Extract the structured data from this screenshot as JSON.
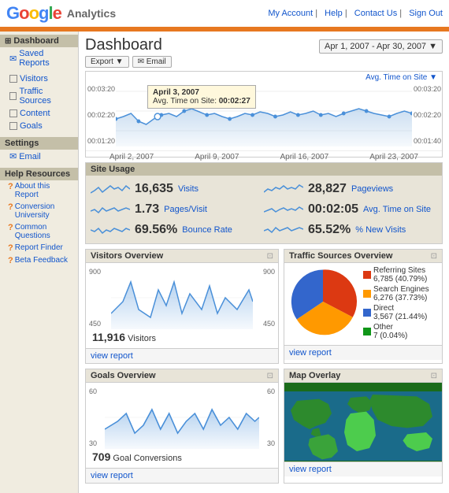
{
  "header": {
    "logo_letters": [
      "G",
      "o",
      "o",
      "g",
      "l",
      "e"
    ],
    "analytics_label": "Analytics",
    "nav_links": [
      "My Account",
      "Help",
      "Contact Us",
      "Sign Out"
    ]
  },
  "sidebar": {
    "sections": [
      {
        "title": "Dashboard",
        "items": [
          {
            "label": "Saved Reports",
            "icon": "📋",
            "active": false
          }
        ]
      },
      {
        "title": null,
        "items": [
          {
            "label": "Visitors",
            "icon": "👤",
            "active": false
          },
          {
            "label": "Traffic Sources",
            "icon": "📊",
            "active": false
          },
          {
            "label": "Content",
            "icon": "📄",
            "active": false
          },
          {
            "label": "Goals",
            "icon": "🎯",
            "active": false
          }
        ]
      }
    ],
    "settings_section": {
      "title": "Settings",
      "items": [
        {
          "label": "Email",
          "icon": "✉"
        }
      ]
    },
    "help_section": {
      "title": "Help Resources",
      "items": [
        {
          "label": "About this Report"
        },
        {
          "label": "Conversion University"
        },
        {
          "label": "Common Questions"
        },
        {
          "label": "Report Finder"
        },
        {
          "label": "Beta Feedback"
        }
      ]
    }
  },
  "dashboard": {
    "title": "Dashboard",
    "toolbar": {
      "export_label": "Export ▼",
      "email_label": "✉ Email"
    },
    "date_range": "Apr 1, 2007 - Apr 30, 2007 ▼",
    "chart": {
      "metric_label": "Avg. Time on Site ▼",
      "y_labels_left": [
        "00:03:20",
        "00:02:20",
        "00:01:20"
      ],
      "y_labels_right": [
        "00:03:20",
        "00:02:20",
        "00:01:40"
      ],
      "x_labels": [
        "April 2, 2007",
        "April 9, 2007",
        "April 16, 2007",
        "April 23, 2007"
      ],
      "tooltip": {
        "date": "April 3, 2007",
        "label": "Avg. Time on Site:",
        "value": "00:02:27"
      }
    },
    "site_usage": {
      "title": "Site Usage",
      "metrics": [
        {
          "value": "16,635",
          "label": "Visits"
        },
        {
          "value": "28,827",
          "label": "Pageviews"
        },
        {
          "value": "1.73",
          "label": "Pages/Visit"
        },
        {
          "value": "00:02:05",
          "label": "Avg. Time on Site"
        },
        {
          "value": "69.56%",
          "label": "Bounce Rate"
        },
        {
          "value": "65.52%",
          "label": "% New Visits"
        }
      ]
    },
    "visitors_overview": {
      "title": "Visitors Overview",
      "visitors_count": "11,916",
      "visitors_label": "Visitors",
      "view_report": "view report"
    },
    "traffic_sources": {
      "title": "Traffic Sources Overview",
      "view_report": "view report",
      "legend": [
        {
          "label": "Referring Sites",
          "sublabel": "6,785 (40.79%)",
          "color": "#dc3912"
        },
        {
          "label": "Search Engines",
          "sublabel": "6,276 (37.73%)",
          "color": "#ff9900"
        },
        {
          "label": "Direct",
          "sublabel": "3,567 (21.44%)",
          "color": "#3366cc"
        },
        {
          "label": "Other",
          "sublabel": "7 (0.04%)",
          "color": "#109618"
        }
      ],
      "pie_data": [
        {
          "value": 40.79,
          "color": "#dc3912"
        },
        {
          "value": 37.73,
          "color": "#ff9900"
        },
        {
          "value": 21.44,
          "color": "#3366cc"
        },
        {
          "value": 0.04,
          "color": "#109618"
        }
      ]
    },
    "goals_overview": {
      "title": "Goals Overview",
      "conversions": "709",
      "conversions_label": "Goal Conversions",
      "view_report": "view report"
    },
    "map_overlay": {
      "title": "Map Overlay",
      "view_report": "view report"
    }
  }
}
